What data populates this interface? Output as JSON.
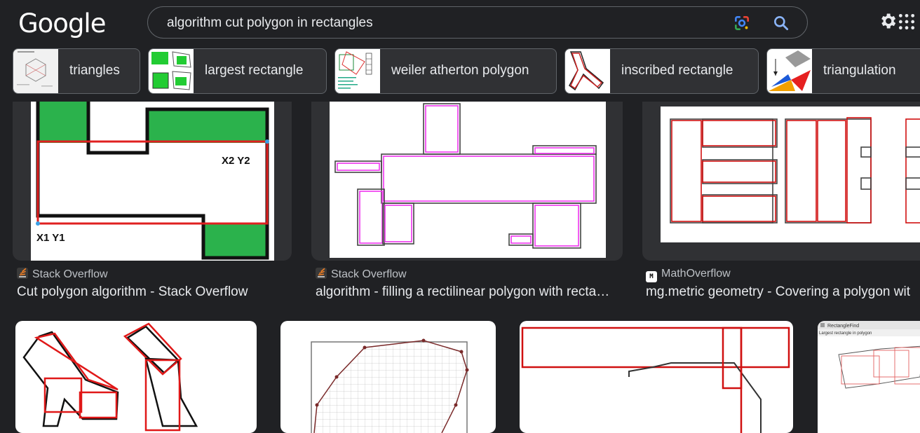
{
  "header": {
    "logo": "Google",
    "query": "algorithm cut polygon in rectangles"
  },
  "chips": [
    {
      "label": "triangles"
    },
    {
      "label": "largest rectangle"
    },
    {
      "label": "weiler atherton polygon"
    },
    {
      "label": "inscribed rectangle"
    },
    {
      "label": "triangulation"
    }
  ],
  "results": [
    {
      "source": "Stack Overflow",
      "title": "Cut polygon algorithm - Stack Overflow",
      "label_a": "X2 Y2",
      "label_b": "X1 Y1"
    },
    {
      "source": "Stack Overflow",
      "title": "algorithm - filling a rectilinear polygon with recta…"
    },
    {
      "source": "MathOverflow",
      "title": "mg.metric geometry - Covering a polygon wit"
    }
  ],
  "tile4": {
    "caption": "RectangleFind",
    "subcaption": "Largest rectangle in polygon"
  },
  "colors": {
    "background": "#202124",
    "accent": "#8ab4f8",
    "chip": "#303134",
    "so_orange": "#f48024"
  }
}
